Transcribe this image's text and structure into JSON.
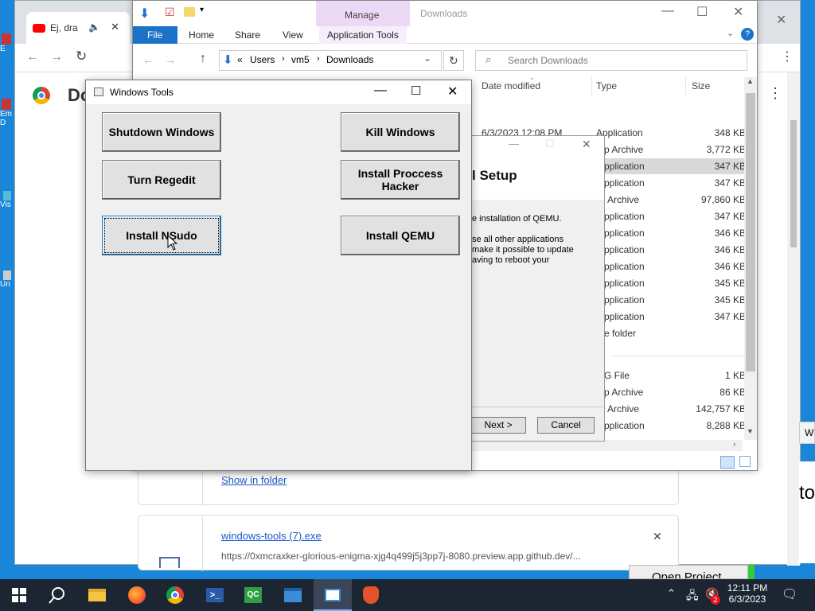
{
  "desktop": {
    "icon_labels": [
      "E",
      "Em",
      "D",
      "Vis",
      "Un"
    ]
  },
  "chrome": {
    "tab_title": "Ej, dra",
    "page_heading": "Do",
    "downloads": [
      {
        "action": "Show in folder"
      },
      {
        "filename": "windows-tools (7).exe",
        "url": "https://0xmcraxker-glorious-enigma-xjg4q499j5j3pp7j-8080.preview.app.github.dev/..."
      }
    ],
    "side_tab": "W",
    "side_text": "to",
    "open_project": "Open Project"
  },
  "explorer": {
    "manage_label": "Manage",
    "title": "Downloads",
    "tabs": [
      "File",
      "Home",
      "Share",
      "View",
      "Application Tools"
    ],
    "address_parts": [
      "«",
      "Users",
      "vm5",
      "Downloads"
    ],
    "search_placeholder": "Search Downloads",
    "columns": {
      "date": "Date modified",
      "type": "Type",
      "size": "Size"
    },
    "rows": [
      {
        "date": "6/3/2023 12:08 PM",
        "type": "Application",
        "size": "348 KB"
      },
      {
        "date": "",
        "type": "p Archive",
        "size": "3,772 KB"
      },
      {
        "date": "",
        "type": "pplication",
        "size": "347 KB"
      },
      {
        "date": "",
        "type": "pplication",
        "size": "347 KB"
      },
      {
        "date": "",
        "type": "Archive",
        "size": "97,860 KB"
      },
      {
        "date": "",
        "type": "pplication",
        "size": "347 KB"
      },
      {
        "date": "",
        "type": "pplication",
        "size": "346 KB"
      },
      {
        "date": "",
        "type": "pplication",
        "size": "346 KB"
      },
      {
        "date": "",
        "type": "pplication",
        "size": "346 KB"
      },
      {
        "date": "",
        "type": "pplication",
        "size": "345 KB"
      },
      {
        "date": "",
        "type": "pplication",
        "size": "345 KB"
      },
      {
        "date": "",
        "type": "pplication",
        "size": "347 KB"
      },
      {
        "date": "",
        "type": "e folder",
        "size": ""
      },
      {
        "date": "",
        "type": "G File",
        "size": "1 KB"
      },
      {
        "date": "",
        "type": "p Archive",
        "size": "86 KB"
      },
      {
        "date": "",
        "type": "Archive",
        "size": "142,757 KB"
      },
      {
        "date": "",
        "type": "pplication",
        "size": "8,288 KB"
      }
    ]
  },
  "setup": {
    "heading": "l Setup",
    "line1": "e installation of QEMU.",
    "line2": "se all other applications",
    "line3": "make it possible to update",
    "line4": "aving to reboot your",
    "next_label": "Next >",
    "cancel_label": "Cancel"
  },
  "tools": {
    "title": "Windows Tools",
    "buttons": {
      "shutdown": "Shutdown Windows",
      "kill": "Kill Windows",
      "regedit": "Turn Regedit",
      "process_hacker": "Install Proccess Hacker",
      "nsudo": "Install NSudo",
      "qemu": "Install QEMU"
    }
  },
  "taskbar": {
    "time": "12:11 PM",
    "date": "6/3/2023",
    "notification_count": "2"
  }
}
